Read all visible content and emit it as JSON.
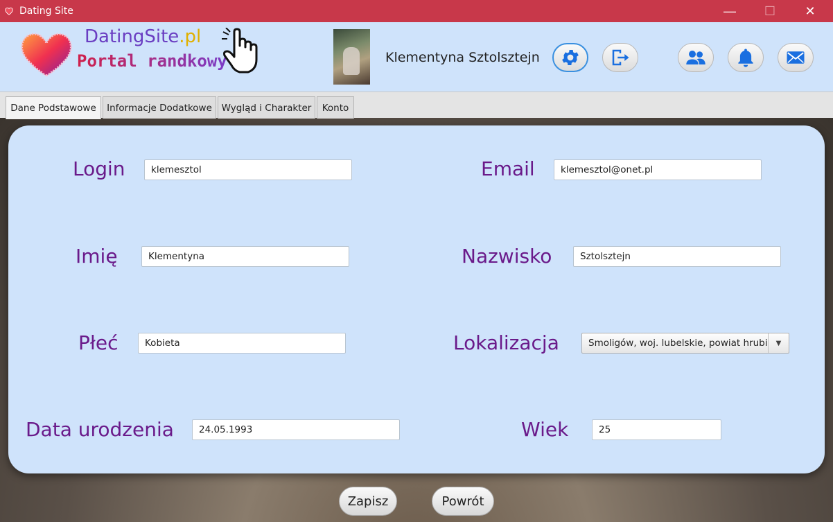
{
  "window": {
    "title": "Dating Site",
    "controls": {
      "minimize": "—",
      "maximize": "☐",
      "close": "✕"
    }
  },
  "header": {
    "brand_main": "DatingSite",
    "brand_tld": ".pl",
    "brand_tagline": "Portal randkowy",
    "username": "Klementyna Sztolsztejn",
    "icons": [
      "settings-icon",
      "logout-icon",
      "friends-icon",
      "bell-icon",
      "mail-icon"
    ],
    "accent_color": "#1a6fe0"
  },
  "tabs": [
    {
      "label": "Dane Podstawowe",
      "active": true
    },
    {
      "label": "Informacje Dodatkowe",
      "active": false
    },
    {
      "label": "Wygląd i Charakter",
      "active": false
    },
    {
      "label": "Konto",
      "active": false
    }
  ],
  "form": {
    "login": {
      "label": "Login",
      "value": "klemesztol"
    },
    "email": {
      "label": "Email",
      "value": "klemesztol@onet.pl"
    },
    "first_name": {
      "label": "Imię",
      "value": "Klementyna"
    },
    "last_name": {
      "label": "Nazwisko",
      "value": "Sztolsztejn"
    },
    "gender": {
      "label": "Płeć",
      "value": "Kobieta"
    },
    "location": {
      "label": "Lokalizacja",
      "value": "Smoligów, woj. lubelskie, powiat hrubi"
    },
    "birth_date": {
      "label": "Data urodzenia",
      "value": "24.05.1993"
    },
    "age": {
      "label": "Wiek",
      "value": "25"
    }
  },
  "actions": {
    "save": "Zapisz",
    "back": "Powrót"
  },
  "colors": {
    "titlebar": "#c8384a",
    "header_bg": "#cfe3fb",
    "label": "#6a1a8a"
  }
}
